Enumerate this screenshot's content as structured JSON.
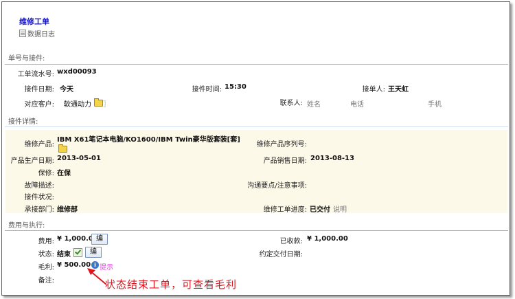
{
  "header": {
    "title": "维修工单",
    "sub_link": "数据日志"
  },
  "sections": {
    "order_pickup": "单号与接件:",
    "pickup_detail": "接件详情:",
    "cost_exec": "费用与执行:"
  },
  "order": {
    "serial_label": "工单流水号:",
    "serial_value": "wxd00093",
    "date_label": "接件日期:",
    "date_value": "今天",
    "time_label": "接件时间:",
    "time_value": "15:30",
    "receiver_label": "接单人:",
    "receiver_value": "王天虹",
    "customer_label": "对应客户:",
    "customer_value": "软通动力",
    "contact_label": "联系人:",
    "contact_name": "姓名",
    "contact_phone": "电话",
    "contact_mobile": "手机"
  },
  "detail": {
    "product_label": "维修产品:",
    "product_value": "IBM X61笔记本电脑/KO1600/IBM Twin豪华版套装[套]",
    "serial_label": "维修产品序列号:",
    "prod_date_label": "产品生产日期:",
    "prod_date_value": "2013-05-01",
    "sale_date_label": "产品销售日期:",
    "sale_date_value": "2013-08-13",
    "warranty_label": "保修:",
    "warranty_value": "在保",
    "fault_label": "故障描述:",
    "notes_label": "沟通要点/注意事项:",
    "condition_label": "接件状况:",
    "dept_label": "承接部门:",
    "dept_value": "维修部",
    "progress_label": "维修工单进度:",
    "progress_value": "已交付",
    "progress_note": "说明"
  },
  "cost": {
    "fee_label": "费用:",
    "fee_value": "¥ 1,000.00",
    "edit_label": "编",
    "received_label": "已收款:",
    "received_value": "¥ 1,000.00",
    "status_label": "状态:",
    "status_value": "结束",
    "delivery_label": "约定交付日期:",
    "profit_label": "毛利:",
    "profit_value": "¥ 500.00",
    "hint_label": "提示",
    "info_glyph": "i",
    "remark_label": "备注:"
  },
  "annotation": {
    "text": "状态结束工单，可查看毛利",
    "color": "#e0141e"
  },
  "colors": {
    "title": "#1010c8",
    "divider": "#8fb6de",
    "highlight_bg": "#fdf9e8",
    "hint": "#e040e0"
  }
}
